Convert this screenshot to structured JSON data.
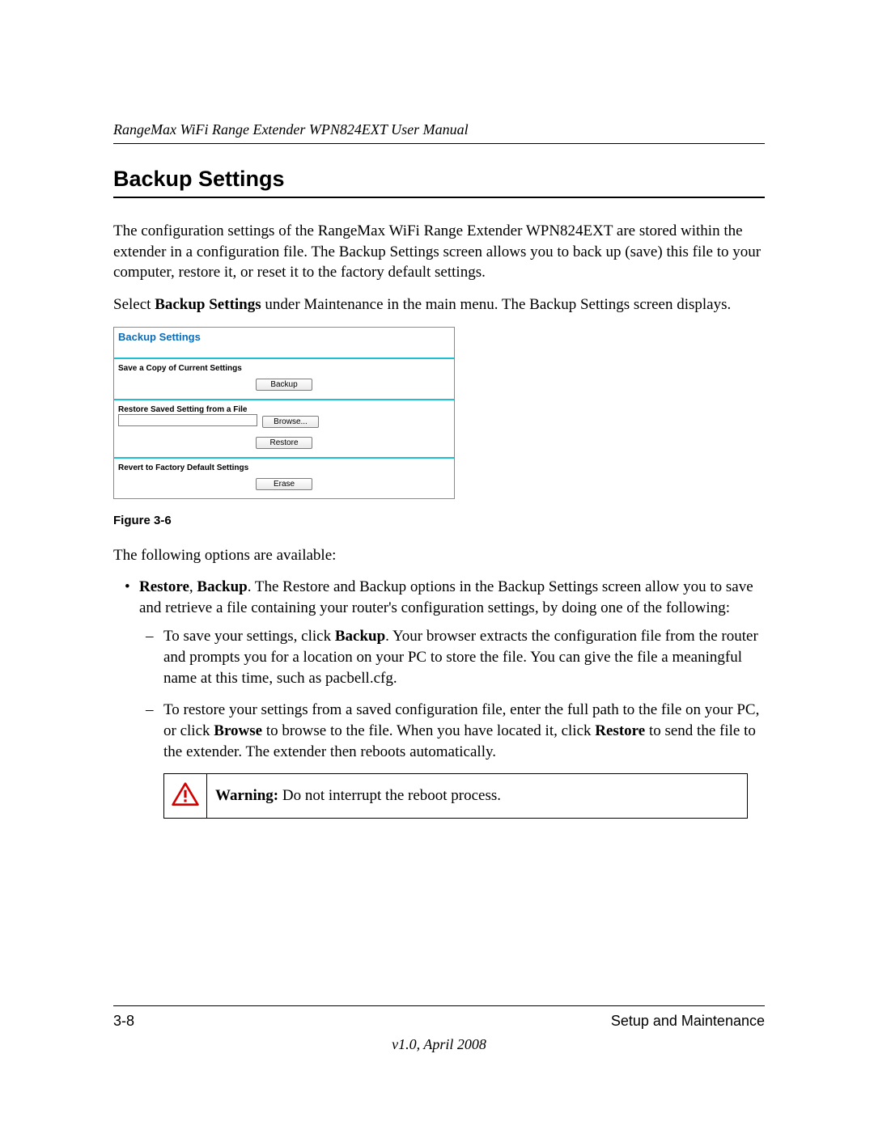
{
  "header": {
    "running_title": "RangeMax WiFi Range Extender WPN824EXT User Manual"
  },
  "heading": "Backup Settings",
  "paragraphs": {
    "intro1": "The configuration settings of the RangeMax WiFi Range Extender WPN824EXT are stored within the extender in a configuration file. The Backup Settings screen allows you to back up (save) this file to your computer, restore it, or reset it to the factory default settings.",
    "intro2_pre": "Select ",
    "intro2_bold": "Backup Settings",
    "intro2_post": " under Maintenance in the main menu. The Backup Settings screen displays.",
    "options_lead": "The following options are available:"
  },
  "screenshot": {
    "title": "Backup Settings",
    "section1_label": "Save a Copy of Current Settings",
    "backup_btn": "Backup",
    "section2_label": "Restore Saved Setting from a File",
    "browse_btn": "Browse...",
    "restore_btn": "Restore",
    "section3_label": "Revert to Factory Default Settings",
    "erase_btn": "Erase"
  },
  "figure_caption": "Figure 3-6",
  "bullets": {
    "item1_bold": "Restore",
    "item1_sep": ", ",
    "item1_bold2": "Backup",
    "item1_rest": ". The Restore and Backup options in the Backup Settings screen allow you to save and retrieve a file containing your router's configuration settings, by doing one of the following:",
    "sub1_pre": "To save your settings, click ",
    "sub1_bold": "Backup",
    "sub1_post": ". Your browser extracts the configuration file from the router and prompts you for a location on your PC to store the file. You can give the file a meaningful name at this time, such as pacbell.cfg.",
    "sub2_pre": "To restore your settings from a saved configuration file, enter the full path to the file on your PC, or click ",
    "sub2_bold1": "Browse",
    "sub2_mid": " to browse to the file. When you have located it, click ",
    "sub2_bold2": "Restore",
    "sub2_post": " to send the file to the extender. The extender then reboots automatically."
  },
  "warning": {
    "label": "Warning:",
    "text": " Do not interrupt the reboot process."
  },
  "footer": {
    "page": "3-8",
    "section": "Setup and Maintenance",
    "version": "v1.0, April 2008"
  }
}
